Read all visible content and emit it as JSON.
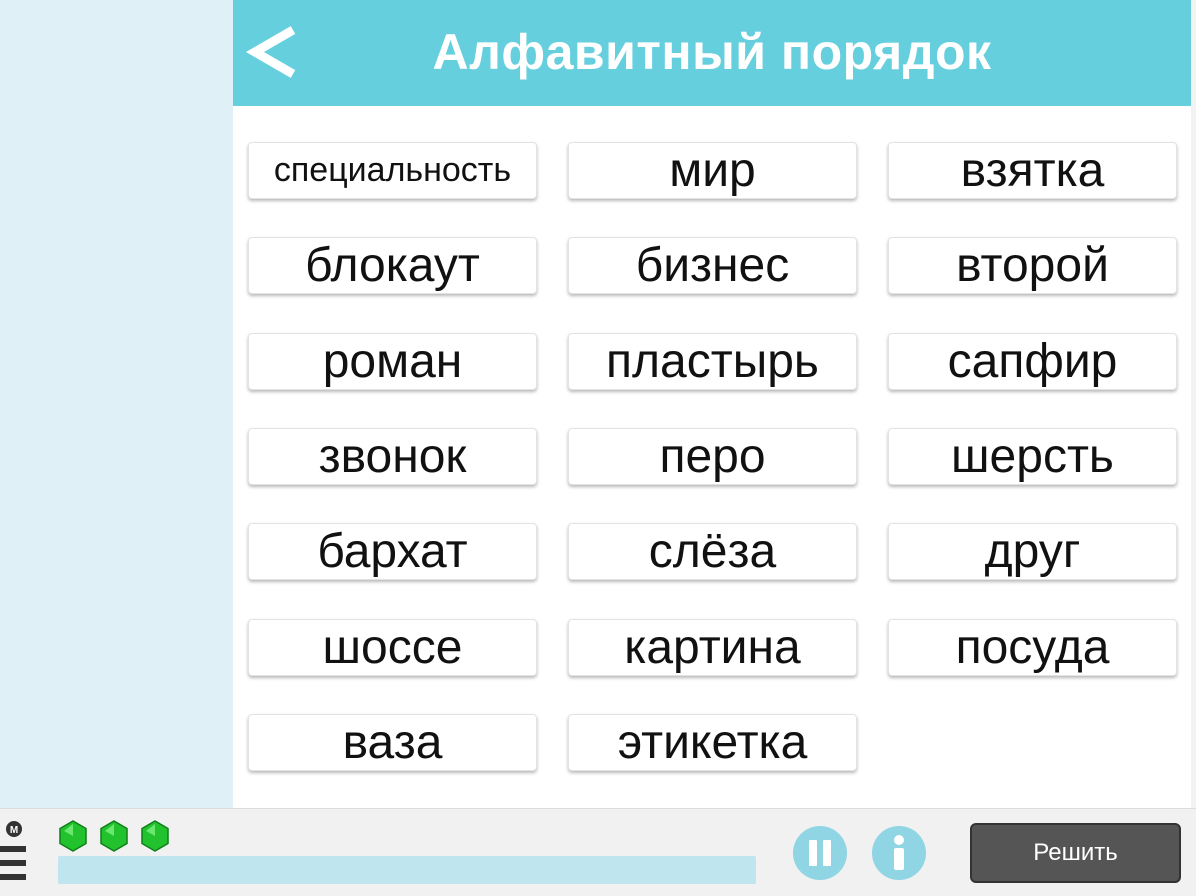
{
  "header": {
    "title": "Алфавитный порядок"
  },
  "words": [
    "специальность",
    "мир",
    "взятка",
    "блокаут",
    "бизнес",
    "второй",
    "роман",
    "пластырь",
    "сапфир",
    "звонок",
    "перо",
    "шерсть",
    "бархат",
    "слёза",
    "друг",
    "шоссе",
    "картина",
    "посуда",
    "ваза",
    "этикетка"
  ],
  "footer": {
    "solve_label": "Решить",
    "menu_badge": "M",
    "gems_count": 3,
    "progress_fraction": 0
  },
  "icons": {
    "back": "chevron-left-icon",
    "pause": "pause-icon",
    "info": "info-icon",
    "menu": "menu-icon",
    "gem": "green-gem-icon"
  },
  "colors": {
    "header": "#66cfde",
    "left_panel": "#dff1f6",
    "gem": "#22c22e",
    "round_buttons": "#8fd5e4",
    "solve_button": "#555555"
  }
}
